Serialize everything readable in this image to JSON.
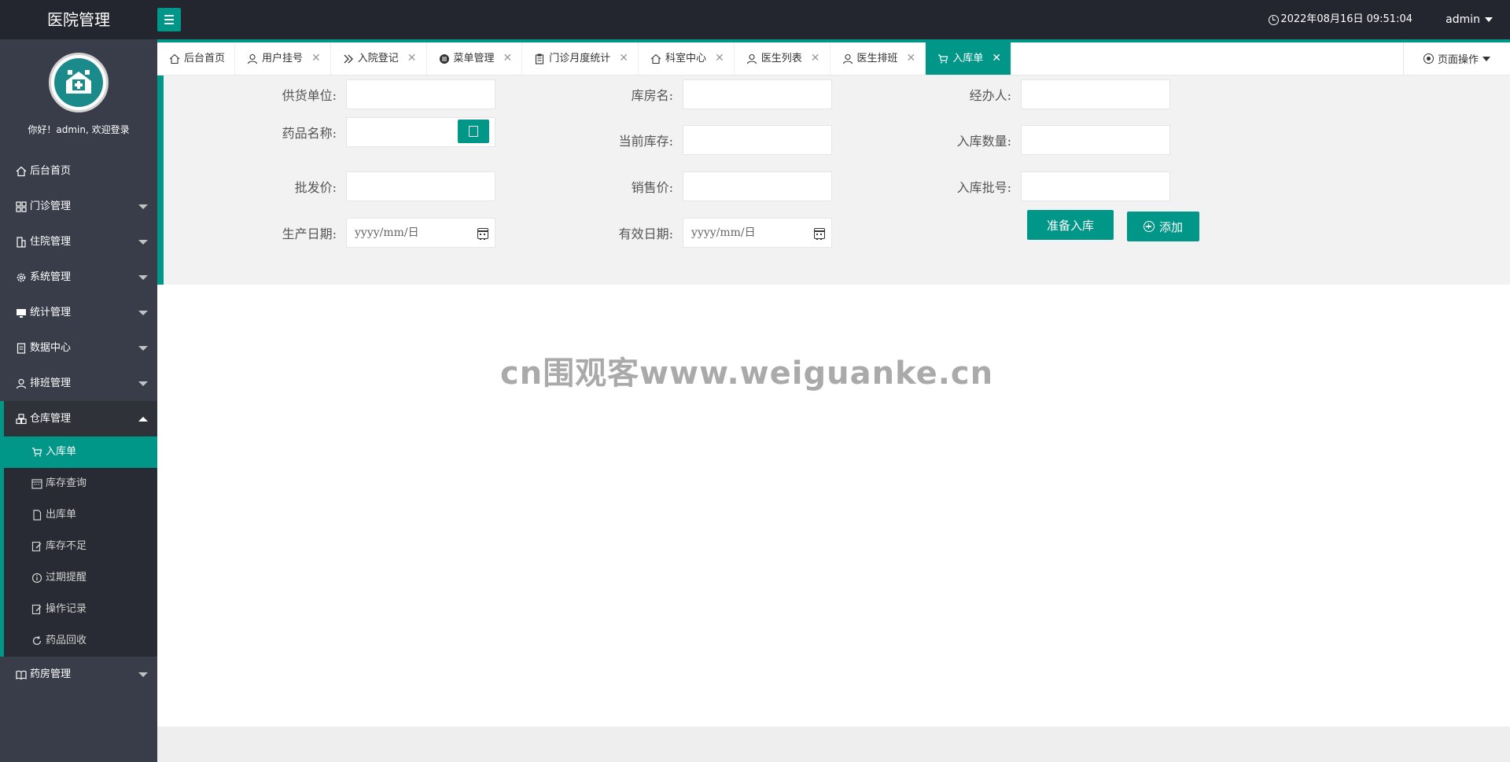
{
  "header": {
    "logo": "医院管理",
    "datetime": "2022年08月16日 09:51:04",
    "user": "admin"
  },
  "sidebar": {
    "welcome": "你好！admin, 欢迎登录",
    "items": [
      {
        "label": "后台首页",
        "icon": "home-icon"
      },
      {
        "label": "门诊管理",
        "icon": "grid-icon"
      },
      {
        "label": "住院管理",
        "icon": "building-icon"
      },
      {
        "label": "系统管理",
        "icon": "gear-icon"
      },
      {
        "label": "统计管理",
        "icon": "monitor-icon"
      },
      {
        "label": "数据中心",
        "icon": "document-icon"
      },
      {
        "label": "排班管理",
        "icon": "user-icon"
      },
      {
        "label": "仓库管理",
        "icon": "boxes-icon"
      }
    ],
    "sub_items": [
      {
        "label": "入库单",
        "icon": "cart-icon"
      },
      {
        "label": "库存查询",
        "icon": "calendar-icon"
      },
      {
        "label": "出库单",
        "icon": "file-icon"
      },
      {
        "label": "库存不足",
        "icon": "edit-icon"
      },
      {
        "label": "过期提醒",
        "icon": "info-icon"
      },
      {
        "label": "操作记录",
        "icon": "edit-icon"
      },
      {
        "label": "药品回收",
        "icon": "refresh-icon"
      }
    ],
    "last_item": {
      "label": "药房管理",
      "icon": "book-icon"
    }
  },
  "tabs": [
    {
      "label": "后台首页",
      "icon": "home-icon",
      "closable": false
    },
    {
      "label": "用户挂号",
      "icon": "user-icon",
      "closable": true
    },
    {
      "label": "入院登记",
      "icon": "double-chevron-icon",
      "closable": true
    },
    {
      "label": "菜单管理",
      "icon": "menu-circle-icon",
      "closable": true
    },
    {
      "label": "门诊月度统计",
      "icon": "clipboard-icon",
      "closable": true
    },
    {
      "label": "科室中心",
      "icon": "home-icon",
      "closable": true
    },
    {
      "label": "医生列表",
      "icon": "user-icon",
      "closable": true
    },
    {
      "label": "医生排班",
      "icon": "user-icon",
      "closable": true
    },
    {
      "label": "入库单",
      "icon": "cart-icon",
      "closable": true
    }
  ],
  "page_ops": "页面操作",
  "form": {
    "supplier_label": "供货单位:",
    "warehouse_label": "库房名:",
    "handler_label": "经办人:",
    "drug_name_label": "药品名称:",
    "current_stock_label": "当前库存:",
    "in_qty_label": "入库数量:",
    "wholesale_label": "批发价:",
    "sale_price_label": "销售价:",
    "batch_label": "入库批号:",
    "production_date_label": "生产日期:",
    "expiry_date_label": "有效日期:",
    "date_placeholder": "yyyy/mm/日",
    "prepare_button": "准备入库",
    "add_button": "添加"
  },
  "watermark": "cn围观客www.weiguanke.cn",
  "colors": {
    "accent": "#009688",
    "header_bg": "#23262e",
    "sidebar_bg": "#393d49"
  }
}
